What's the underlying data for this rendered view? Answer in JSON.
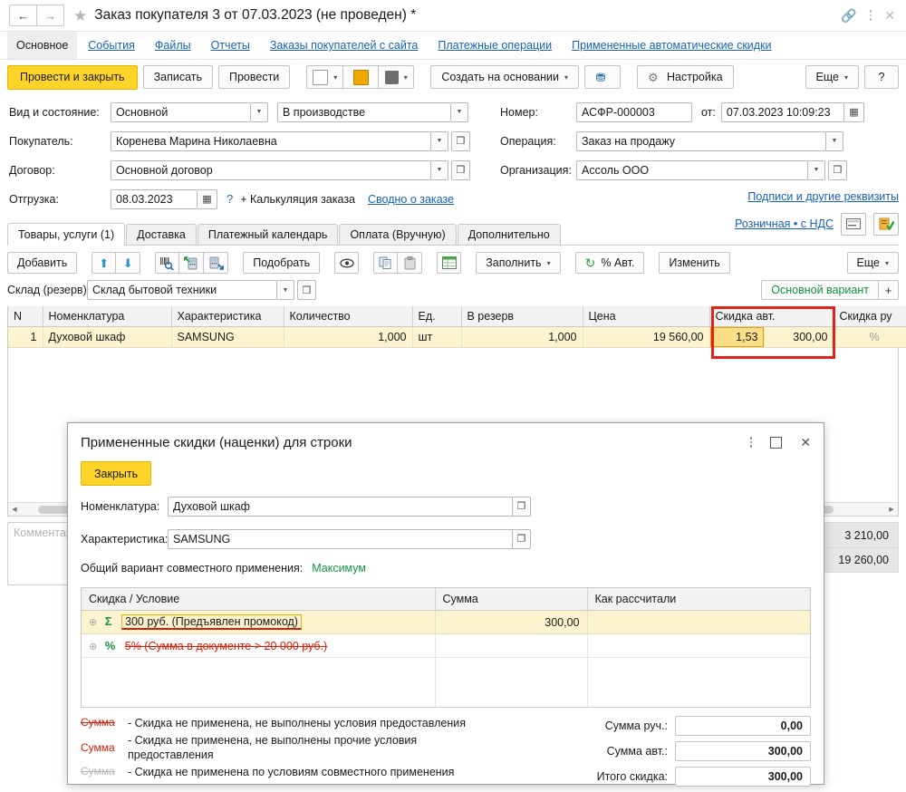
{
  "titlebar": {
    "back_icon": "arrow-left-icon",
    "forward_icon": "arrow-right-icon",
    "favorite_icon": "star-icon",
    "title": "Заказ покупателя 3 от 07.03.2023 (не проведен) *",
    "link_icon": "link-icon",
    "menu_icon": "kebab-menu-icon",
    "close_icon": "close-icon"
  },
  "nav": {
    "items": [
      {
        "label": "Основное",
        "active": true
      },
      {
        "label": "События",
        "active": false
      },
      {
        "label": "Файлы",
        "active": false
      },
      {
        "label": "Отчеты",
        "active": false
      },
      {
        "label": "Заказы покупателей с сайта",
        "active": false
      },
      {
        "label": "Платежные операции",
        "active": false
      },
      {
        "label": "Примененные автоматические скидки",
        "active": false
      }
    ]
  },
  "commandbar": {
    "post_and_close": "Провести и закрыть",
    "write": "Записать",
    "post": "Провести",
    "create_based_on": "Создать на основании",
    "settings": "Настройка",
    "more": "Еще",
    "help": "?",
    "icons": {
      "report_icon": "document-report-icon",
      "mail_icon": "envelope-icon",
      "print_icon": "printer-icon",
      "structure_icon": "structure-tree-icon",
      "gear_icon": "gear-icon"
    }
  },
  "header_form": {
    "kind_state_label": "Вид и состояние:",
    "kind_value": "Основной",
    "state_value": "В производстве",
    "buyer_label": "Покупатель:",
    "buyer_value": "Коренева Марина Николаевна",
    "contract_label": "Договор:",
    "contract_value": "Основной договор",
    "shipment_label": "Отгрузка:",
    "shipment_value": "08.03.2023",
    "shipment_help": "?",
    "calc_link": "+ Калькуляция заказа",
    "summary_link": "Сводно о заказе",
    "number_label": "Номер:",
    "number_value": "АСФР-000003",
    "date_prefix": "от:",
    "date_value": "07.03.2023 10:09:23",
    "operation_label": "Операция:",
    "operation_value": "Заказ на продажу",
    "organization_label": "Организация:",
    "organization_value": "Ассоль ООО",
    "signatures_link": "Подписи и другие реквизиты",
    "price_link": "Розничная • с НДС"
  },
  "section_tabs": [
    {
      "label": "Товары, услуги (1)",
      "active": true
    },
    {
      "label": "Доставка",
      "active": false
    },
    {
      "label": "Платежный календарь",
      "active": false
    },
    {
      "label": "Оплата (Вручную)",
      "active": false
    },
    {
      "label": "Дополнительно",
      "active": false
    }
  ],
  "table_toolbar": {
    "add": "Добавить",
    "up_icon": "arrow-up-icon",
    "down_icon": "arrow-down-icon",
    "barcode_icon": "barcode-scan-icon",
    "import_tsd_icon": "tsd-import-icon",
    "export_tsd_icon": "tsd-export-icon",
    "pick": "Подобрать",
    "view_icon": "eye-icon",
    "copy_icon": "copy-icon",
    "paste_icon": "paste-icon",
    "table_icon": "spreadsheet-icon",
    "fill": "Заполнить",
    "auto_percent": "% Авт.",
    "refresh_icon": "refresh-icon",
    "change": "Изменить",
    "more": "Еще"
  },
  "warehouse": {
    "label": "Склад (резерв):",
    "value": "Склад бытовой техники",
    "variant": "Основной вариант",
    "variant_plus": "+"
  },
  "grid": {
    "columns": [
      "N",
      "Номенклатура",
      "Характеристика",
      "Количество",
      "Ед.",
      "В резерв",
      "Цена",
      "Скидка авт.",
      "",
      "Скидка ру"
    ],
    "rows": [
      {
        "n": "1",
        "nomenclature": "Духовой шкаф",
        "characteristic": "SAMSUNG",
        "quantity": "1,000",
        "unit": "шт",
        "reserve": "1,000",
        "price": "19 560,00",
        "discount_auto_pct": "1,53",
        "discount_auto_sum": "300,00",
        "discount_manual": "%"
      }
    ]
  },
  "comment": {
    "placeholder": "Комментарий"
  },
  "totals": [
    {
      "value": "3 210,00"
    },
    {
      "value": "19 260,00"
    }
  ],
  "modal": {
    "title": "Примененные скидки (наценки) для строки",
    "menu_icon": "kebab-menu-icon",
    "maximize_icon": "maximize-icon",
    "close_icon": "close-icon",
    "close_button": "Закрыть",
    "nomenclature_label": "Номенклатура:",
    "nomenclature_value": "Духовой шкаф",
    "characteristic_label": "Характеристика:",
    "characteristic_value": "SAMSUNG",
    "combine_label": "Общий вариант совместного применения:",
    "combine_value": "Максимум",
    "grid": {
      "columns": [
        "Скидка / Условие",
        "Сумма",
        "Как рассчитали"
      ],
      "rows": [
        {
          "expand_icon": "expand-plus-icon",
          "type_symbol": "Σ",
          "condition": "300 руб. (Предъявлен промокод)",
          "amount": "300,00",
          "how": "",
          "selected": true,
          "struck": false
        },
        {
          "expand_icon": "expand-plus-icon",
          "type_symbol": "%",
          "condition": "5% (Сумма в документе > 20 000 руб.)",
          "amount": "",
          "how": "",
          "selected": false,
          "struck": true
        }
      ]
    },
    "legend": [
      {
        "key": "Сумма",
        "style": "struck-red",
        "text": "- Скидка не применена, не выполнены условия предоставления"
      },
      {
        "key": "Сумма",
        "style": "red",
        "text": "- Скидка не применена, не выполнены прочие условия предоставления"
      },
      {
        "key": "Сумма",
        "style": "struck-gray",
        "text": "- Скидка не применена по условиям совместного применения"
      }
    ],
    "sums": [
      {
        "label": "Сумма руч.:",
        "value": "0,00"
      },
      {
        "label": "Сумма авт.:",
        "value": "300,00"
      },
      {
        "label": "Итого скидка:",
        "value": "300,00"
      }
    ]
  },
  "colors": {
    "accent_yellow": "#ffd42a",
    "link_blue": "#1662b6",
    "green": "#12933f",
    "red_highlight": "#e32219",
    "row_yellow": "#fdf3cf"
  }
}
